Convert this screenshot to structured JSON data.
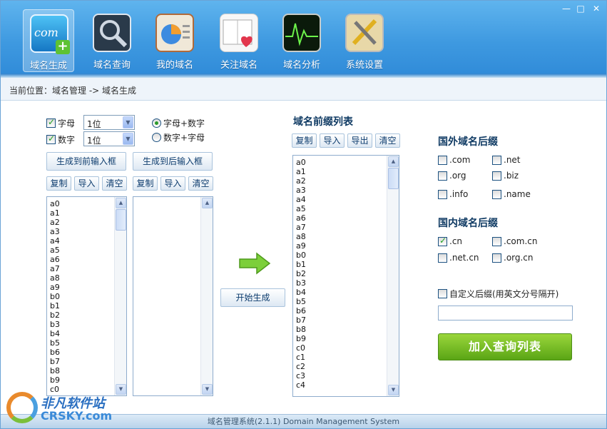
{
  "window": {
    "minimize": "—",
    "maximize": "□",
    "close": "✕"
  },
  "nav": [
    {
      "label": "域名生成",
      "icon": "domain-generate-icon",
      "active": true,
      "icon_text": "com",
      "icon_badge": "+"
    },
    {
      "label": "域名查询",
      "icon": "magnifier-icon"
    },
    {
      "label": "我的域名",
      "icon": "pie-chart-icon"
    },
    {
      "label": "关注域名",
      "icon": "heart-book-icon"
    },
    {
      "label": "域名分析",
      "icon": "oscilloscope-icon"
    },
    {
      "label": "系统设置",
      "icon": "tools-icon"
    }
  ],
  "breadcrumb": "当前位置：域名管理 -> 域名生成",
  "options": {
    "letters_label": "字母",
    "letters_checked": true,
    "letters_length": "1位",
    "digits_label": "数字",
    "digits_checked": true,
    "digits_length": "1位",
    "order_letters_digits": "字母+数字",
    "order_digits_letters": "数字+字母",
    "order_selected": "字母+数字"
  },
  "left_panel": {
    "gen_front_button": "生成到前输入框",
    "gen_back_button": "生成到后输入框",
    "front_actions": [
      "复制",
      "导入",
      "清空"
    ],
    "back_actions": [
      "复制",
      "导入",
      "清空"
    ],
    "front_list": [
      "a0",
      "a1",
      "a2",
      "a3",
      "a4",
      "a5",
      "a6",
      "a7",
      "a8",
      "a9",
      "b0",
      "b1",
      "b2",
      "b3",
      "b4",
      "b5",
      "b6",
      "b7",
      "b8",
      "b9",
      "c0"
    ],
    "back_list": []
  },
  "start_button": "开始生成",
  "prefix_panel": {
    "title": "域名前缀列表",
    "actions": [
      "复制",
      "导入",
      "导出",
      "清空"
    ],
    "list": [
      "a0",
      "a1",
      "a2",
      "a3",
      "a4",
      "a5",
      "a6",
      "a7",
      "a8",
      "a9",
      "b0",
      "b1",
      "b2",
      "b3",
      "b4",
      "b5",
      "b6",
      "b7",
      "b8",
      "b9",
      "c0",
      "c1",
      "c2",
      "c3",
      "c4"
    ]
  },
  "foreign_suffix": {
    "title": "国外域名后缀",
    "items": [
      {
        "label": ".com",
        "checked": false
      },
      {
        "label": ".net",
        "checked": false
      },
      {
        "label": ".org",
        "checked": false
      },
      {
        "label": ".biz",
        "checked": false
      },
      {
        "label": ".info",
        "checked": false
      },
      {
        "label": ".name",
        "checked": false
      }
    ]
  },
  "domestic_suffix": {
    "title": "国内域名后缀",
    "items": [
      {
        "label": ".cn",
        "checked": true
      },
      {
        "label": ".com.cn",
        "checked": false
      },
      {
        "label": ".net.cn",
        "checked": false
      },
      {
        "label": ".org.cn",
        "checked": false
      }
    ]
  },
  "custom_suffix": {
    "label": "自定义后缀(用英文分号隔开)",
    "checked": false,
    "value": ""
  },
  "add_query_button": "加入查询列表",
  "footer": "域名管理系统(2.1.1) Domain Management System",
  "watermark": {
    "text": "非凡软件站",
    "sub": "CRSKY.com"
  },
  "colors": {
    "header": "#3e99e0",
    "accent_green": "#5aa515",
    "title_blue": "#0f3a63"
  }
}
